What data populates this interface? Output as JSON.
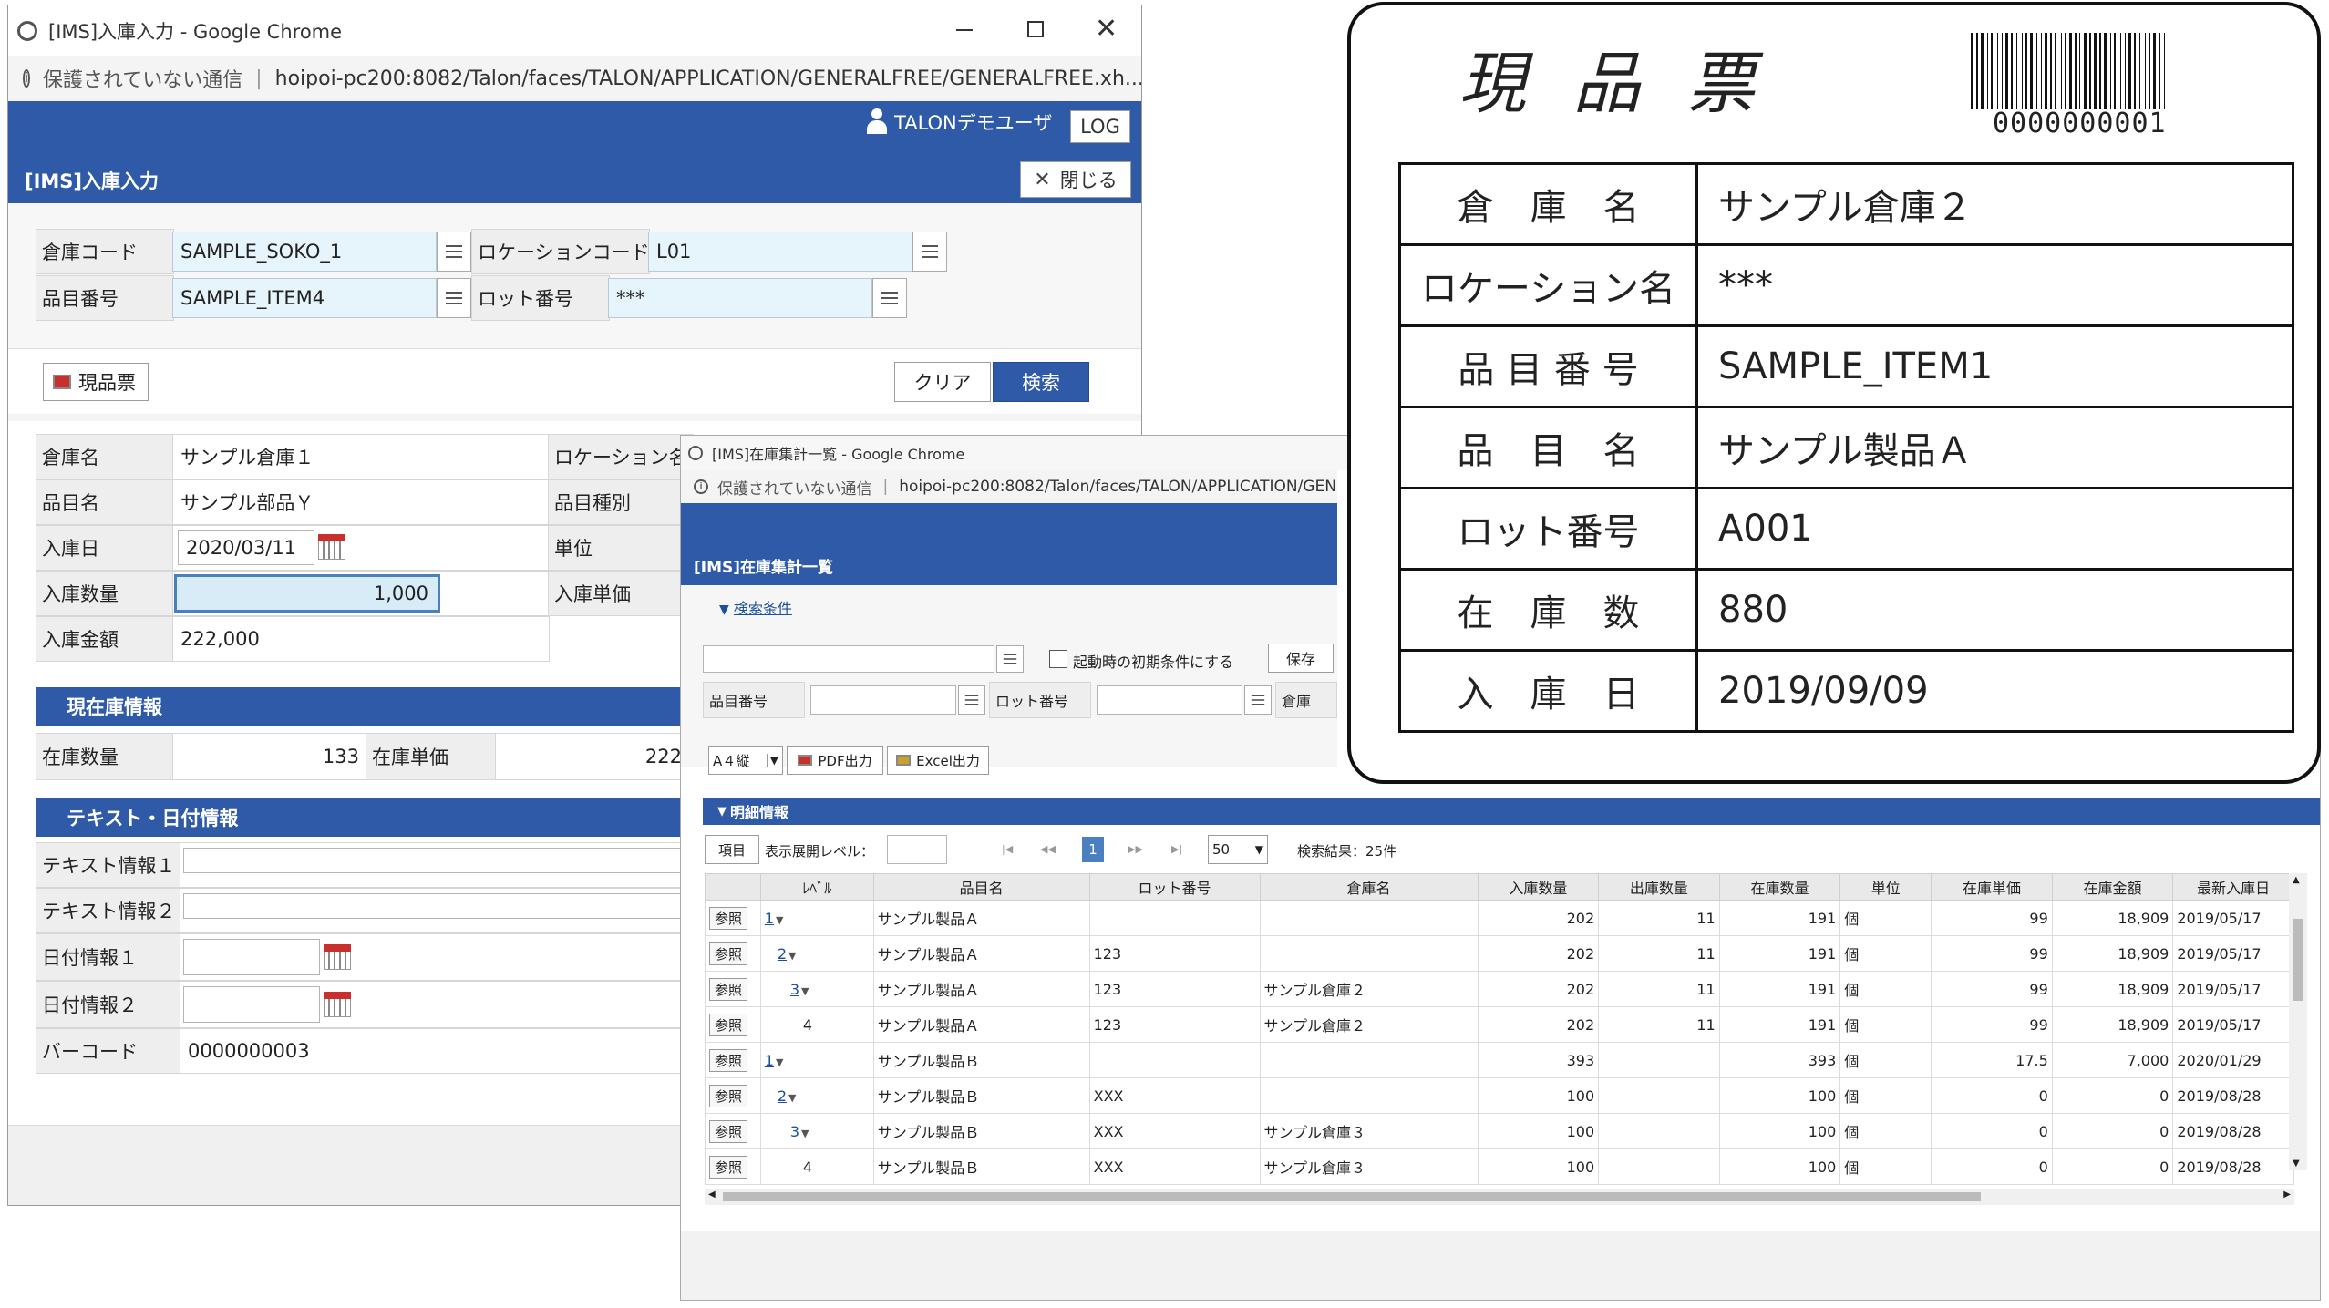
{
  "win1": {
    "title": "[IMS]入庫入力 - Google Chrome",
    "address_insecure": "保護されていない通信",
    "address_url": "hoipoi-pc200:8082/Talon/faces/TALON/APPLICATION/GENERALFREE/GENERALFREE.xh...",
    "user": "TALONデモユーザ",
    "log_button": "LOG",
    "page_title": "[IMS]入庫入力",
    "close_button": "閉じる",
    "search": {
      "warehouse_code_label": "倉庫コード",
      "warehouse_code": "SAMPLE_SOKO_1",
      "location_code_label": "ロケーションコード",
      "location_code": "L01",
      "item_no_label": "品目番号",
      "item_no": "SAMPLE_ITEM4",
      "lot_no_label": "ロット番号",
      "lot_no": "***"
    },
    "slip_button": "現品票",
    "clear_button": "クリア",
    "search_button": "検索",
    "detail": {
      "warehouse_name_label": "倉庫名",
      "warehouse_name": "サンプル倉庫１",
      "location_name_label": "ロケーション名",
      "item_name_label": "品目名",
      "item_name": "サンプル部品Ｙ",
      "item_type_label": "品目種別",
      "in_date_label": "入庫日",
      "in_date": "2020/03/11",
      "unit_label": "単位",
      "in_qty_label": "入庫数量",
      "in_qty": "1,000",
      "in_price_label": "入庫単価",
      "in_amount_label": "入庫金額",
      "in_amount": "222,000"
    },
    "stock_section": "現在庫情報",
    "stock": {
      "qty_label": "在庫数量",
      "qty": "133",
      "price_label": "在庫単価",
      "price": "222"
    },
    "text_section": "テキスト・日付情報",
    "text_info": {
      "text1_label": "テキスト情報１",
      "text2_label": "テキスト情報２",
      "date1_label": "日付情報１",
      "date2_label": "日付情報２",
      "barcode_label": "バーコード",
      "barcode": "0000000003"
    }
  },
  "win2": {
    "title": "[IMS]在庫集計一覧 - Google Chrome",
    "address_insecure": "保護されていない通信",
    "address_url": "hoipoi-pc200:8082/Talon/faces/TALON/APPLICATION/GEN",
    "page_title": "[IMS]在庫集計一覧",
    "search_cond_toggle": "検索条件",
    "startup_checkbox": "起動時の初期条件にする",
    "save_button": "保存",
    "item_no_label": "品目番号",
    "lot_no_label": "ロット番号",
    "warehouse_label": "倉庫",
    "paper_select": "A４縦",
    "pdf_button": "PDF出力",
    "excel_button": "Excel出力",
    "detail_toggle": "明細情報",
    "items_button": "項目",
    "expand_level_label": "表示展開レベル：",
    "pager": {
      "first": "|◀",
      "prev": "◀◀",
      "current": "1",
      "next": "▶▶",
      "last": "▶|"
    },
    "page_size": "50",
    "result_text": "検索結果：25件",
    "ref_label": "参照",
    "columns": [
      "ﾚﾍﾞﾙ",
      "品目名",
      "ロット番号",
      "倉庫名",
      "入庫数量",
      "出庫数量",
      "在庫数量",
      "単位",
      "在庫単価",
      "在庫金額",
      "最新入庫日"
    ],
    "rows": [
      {
        "level": "1",
        "arrow": "▼",
        "indent": 0,
        "link": true,
        "item": "サンプル製品Ａ",
        "lot": "",
        "wh": "",
        "in": "202",
        "out": "11",
        "stock": "191",
        "unit": "個",
        "price": "99",
        "amount": "18,909",
        "date": "2019/05/17"
      },
      {
        "level": "2",
        "arrow": "▼",
        "indent": 1,
        "link": true,
        "item": "サンプル製品Ａ",
        "lot": "123",
        "wh": "",
        "in": "202",
        "out": "11",
        "stock": "191",
        "unit": "個",
        "price": "99",
        "amount": "18,909",
        "date": "2019/05/17"
      },
      {
        "level": "3",
        "arrow": "▼",
        "indent": 2,
        "link": true,
        "item": "サンプル製品Ａ",
        "lot": "123",
        "wh": "サンプル倉庫２",
        "in": "202",
        "out": "11",
        "stock": "191",
        "unit": "個",
        "price": "99",
        "amount": "18,909",
        "date": "2019/05/17"
      },
      {
        "level": "4",
        "arrow": "",
        "indent": 3,
        "link": false,
        "item": "サンプル製品Ａ",
        "lot": "123",
        "wh": "サンプル倉庫２",
        "in": "202",
        "out": "11",
        "stock": "191",
        "unit": "個",
        "price": "99",
        "amount": "18,909",
        "date": "2019/05/17"
      },
      {
        "level": "1",
        "arrow": "▼",
        "indent": 0,
        "link": true,
        "item": "サンプル製品Ｂ",
        "lot": "",
        "wh": "",
        "in": "393",
        "out": "",
        "stock": "393",
        "unit": "個",
        "price": "17.5",
        "amount": "7,000",
        "date": "2020/01/29"
      },
      {
        "level": "2",
        "arrow": "▼",
        "indent": 1,
        "link": true,
        "item": "サンプル製品Ｂ",
        "lot": "XXX",
        "wh": "",
        "in": "100",
        "out": "",
        "stock": "100",
        "unit": "個",
        "price": "0",
        "amount": "0",
        "date": "2019/08/28"
      },
      {
        "level": "3",
        "arrow": "▼",
        "indent": 2,
        "link": true,
        "item": "サンプル製品Ｂ",
        "lot": "XXX",
        "wh": "サンプル倉庫３",
        "in": "100",
        "out": "",
        "stock": "100",
        "unit": "個",
        "price": "0",
        "amount": "0",
        "date": "2019/08/28"
      },
      {
        "level": "4",
        "arrow": "",
        "indent": 3,
        "link": false,
        "item": "サンプル製品Ｂ",
        "lot": "XXX",
        "wh": "サンプル倉庫３",
        "in": "100",
        "out": "",
        "stock": "100",
        "unit": "個",
        "price": "0",
        "amount": "0",
        "date": "2019/08/28"
      }
    ]
  },
  "slip": {
    "title": "現 品 票",
    "barcode": "0000000001",
    "rows": [
      {
        "label": "倉　庫　名",
        "value": "サンプル倉庫２"
      },
      {
        "label": "ロケーション名",
        "value": "***"
      },
      {
        "label": "品 目 番 号",
        "value": "SAMPLE_ITEM1"
      },
      {
        "label": "品　目　名",
        "value": "サンプル製品Ａ"
      },
      {
        "label": "ロット番号",
        "value": "A001"
      },
      {
        "label": "在　庫　数",
        "value": "880"
      },
      {
        "label": "入　庫　日",
        "value": "2019/09/09"
      }
    ]
  },
  "colors": {
    "header_blue": "#2f5aa8",
    "input_bg": "#e6f5fb",
    "label_bg": "#eeeeee",
    "link": "#1b4fa0"
  }
}
